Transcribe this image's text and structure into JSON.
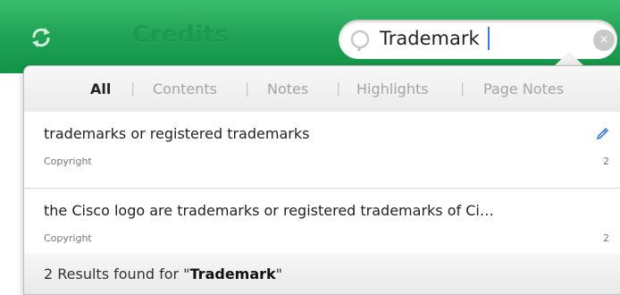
{
  "header": {
    "title": "Credits",
    "sync_icon": "sync-icon"
  },
  "search": {
    "value": "Trademark",
    "icon": "search-icon",
    "clear_icon": "clear-icon",
    "clear_glyph": "×"
  },
  "filters": {
    "tabs": [
      "All",
      "Contents",
      "Notes",
      "Highlights",
      "Page Notes"
    ],
    "separator": "|",
    "active": "All"
  },
  "results": [
    {
      "title": "trademarks or registered trademarks",
      "source": "Copyright",
      "count": "2",
      "has_note_icon": true
    },
    {
      "title": "the Cisco logo are trademarks or registered trademarks of Ci…",
      "source": "Copyright",
      "count": "2",
      "has_note_icon": false
    }
  ],
  "footer": {
    "prefix": "2 Results found for \"",
    "query": "Trademark",
    "suffix": "\""
  },
  "colors": {
    "header_green": "#21a457",
    "note_icon_blue": "#3a7bd5"
  }
}
